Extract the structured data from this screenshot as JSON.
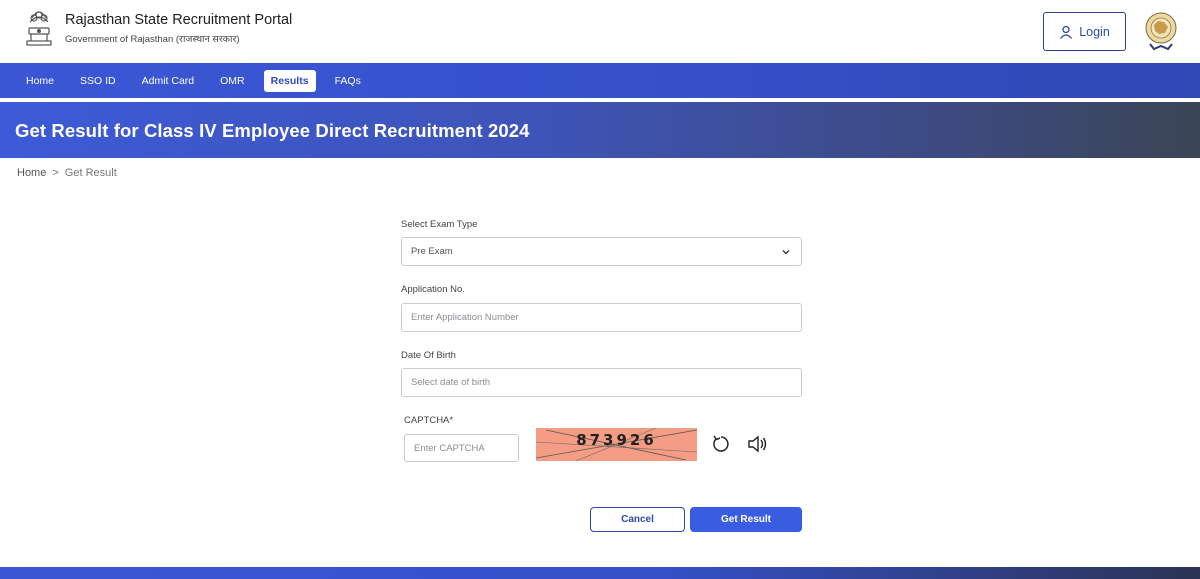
{
  "header": {
    "title": "Rajasthan State Recruitment Portal",
    "subtitle": "Government of Rajasthan (राजस्थान सरकार)",
    "login_label": "Login"
  },
  "nav": {
    "items": [
      {
        "label": "Home",
        "active": false
      },
      {
        "label": "SSO ID",
        "active": false
      },
      {
        "label": "Admit Card",
        "active": false
      },
      {
        "label": "OMR",
        "active": false
      },
      {
        "label": "Results",
        "active": true
      },
      {
        "label": "FAQs",
        "active": false
      }
    ]
  },
  "banner": {
    "title": "Get Result for Class IV Employee Direct Recruitment 2024"
  },
  "breadcrumb": {
    "home": "Home",
    "separator": ">",
    "current": "Get Result"
  },
  "form": {
    "exam_type_label": "Select Exam Type",
    "exam_type_value": "Pre Exam",
    "application_label": "Application No.",
    "application_placeholder": "Enter Application Number",
    "dob_label": "Date Of Birth",
    "dob_placeholder": "Select date of birth",
    "captcha_label": "CAPTCHA*",
    "captcha_placeholder": "Enter CAPTCHA",
    "captcha_code": "873926",
    "cancel_label": "Cancel",
    "submit_label": "Get Result"
  },
  "colors": {
    "primary": "#3a5ce0",
    "nav_bg": "#3b57d6",
    "captcha_bg": "#f59d84"
  },
  "icons": {
    "login": "user-icon",
    "dropdown": "chevron-down-icon",
    "refresh": "refresh-icon",
    "audio": "speaker-icon"
  }
}
